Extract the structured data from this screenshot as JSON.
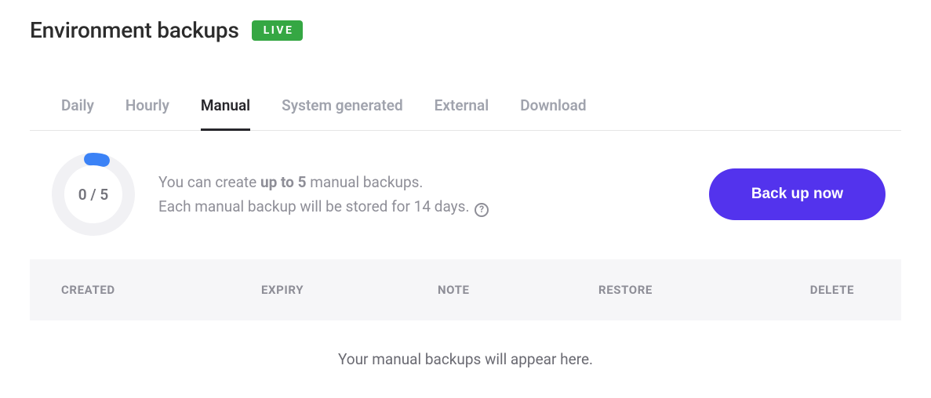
{
  "header": {
    "title": "Environment backups",
    "badge": "LIVE"
  },
  "tabs": [
    {
      "label": "Daily",
      "active": false
    },
    {
      "label": "Hourly",
      "active": false
    },
    {
      "label": "Manual",
      "active": true
    },
    {
      "label": "System generated",
      "active": false
    },
    {
      "label": "External",
      "active": false
    },
    {
      "label": "Download",
      "active": false
    }
  ],
  "gauge": {
    "label": "0 / 5",
    "used": 0,
    "total": 5
  },
  "info": {
    "line1_prefix": "You can create ",
    "line1_strong": "up to 5",
    "line1_suffix": " manual backups.",
    "line2": "Each manual backup will be stored for 14 days. "
  },
  "help_glyph": "?",
  "backup_button": "Back up now",
  "table": {
    "columns": {
      "created": "CREATED",
      "expiry": "EXPIRY",
      "note": "NOTE",
      "restore": "RESTORE",
      "delete": "DELETE"
    },
    "empty_message": "Your manual backups will appear here."
  }
}
